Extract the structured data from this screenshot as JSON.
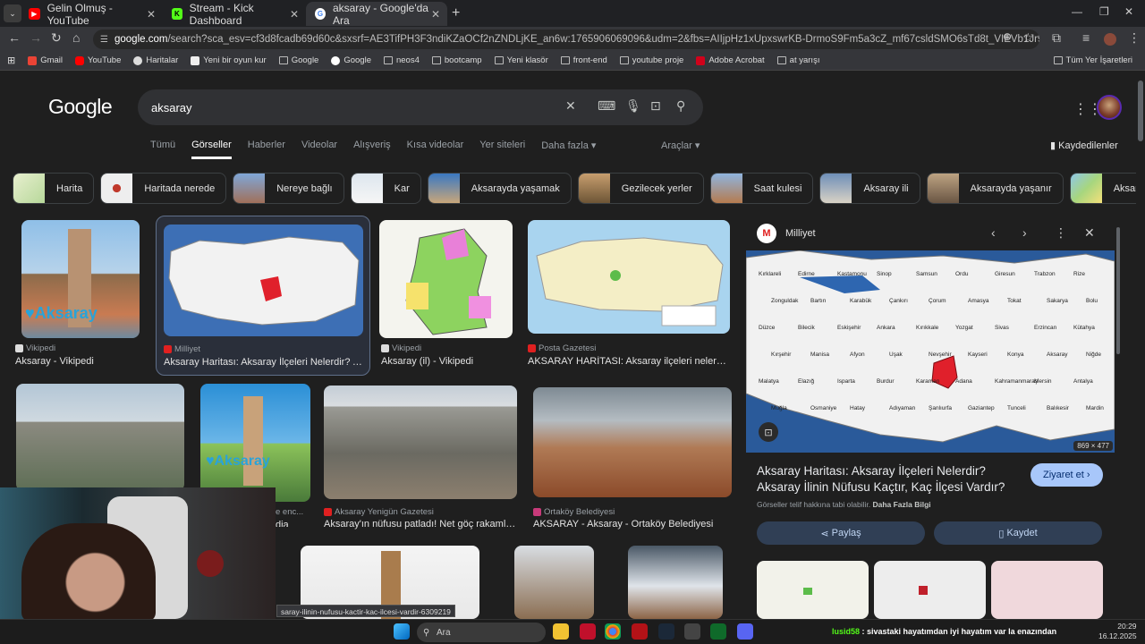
{
  "tabs": [
    {
      "title": "Gelin Olmuş - YouTube",
      "color": "#ff0000",
      "glyph": "▶"
    },
    {
      "title": "Stream - Kick Dashboard",
      "color": "#53fc18",
      "glyph": "K"
    },
    {
      "title": "aksaray - Google'da Ara",
      "color": "#ffffff",
      "glyph": "G"
    }
  ],
  "url": {
    "host": "google.com",
    "rest": "/search?sca_esv=cf3d8fcadb69d60c&sxsrf=AE3TifPH3F3ndiKZaOCf2nZNDLjKE_an6w:1765906069096&udm=2&fbs=AIIjpHz1xUpxswrKB-DrmoS9Fm5a3cZ_mf67csldSMO6sTd8t_VIEVb1Jr9xw1JF7Lq8CmkqOt0ZSNMrQxXLUVYBZ..."
  },
  "bookmarks": [
    "Gmail",
    "YouTube",
    "Haritalar",
    "Yeni bir oyun kur",
    "Google",
    "Google",
    "neos4",
    "bootcamp",
    "Yeni klasör",
    "front-end",
    "youtube proje",
    "Adobe Acrobat",
    "at yarışı"
  ],
  "all_bookmarks": "Tüm Yer İşaretleri",
  "logo": "Google",
  "query": "aksaray",
  "nav": [
    "Tümü",
    "Görseller",
    "Haberler",
    "Videolar",
    "Alışveriş",
    "Kısa videolar",
    "Yer siteleri",
    "Daha fazla"
  ],
  "tools": "Araçlar",
  "saved": "Kaydedilenler",
  "chips": [
    "Harita",
    "Haritada nerede",
    "Nereye bağlı",
    "Kar",
    "Aksarayda yaşamak",
    "Gezilecek yerler",
    "Saat kulesi",
    "Aksaray ili",
    "Aksarayda yaşanır",
    "Aksaray ilçeleri"
  ],
  "results": [
    {
      "source": "Vikipedi",
      "title": "Aksaray - Vikipedi"
    },
    {
      "source": "Milliyet",
      "title": "Aksaray Haritası: Aksaray İlçeleri Nelerdir? A..."
    },
    {
      "source": "Vikipedi",
      "title": "Aksaray (il) - Vikipedi"
    },
    {
      "source": "Posta Gazetesi",
      "title": "AKSARAY HARİTASI: Aksaray ilçeleri nelerdir..."
    },
    {
      "source": "",
      "title": ""
    },
    {
      "source": "e enc...",
      "title": "dia"
    },
    {
      "source": "Aksaray Yenigün Gazetesi",
      "title": "Aksaray'ın nüfusu patladı! Net göç rakamla..."
    },
    {
      "source": "Ortaköy Belediyesi",
      "title": "AKSARAY - Aksaray - Ortaköy Belediyesi"
    }
  ],
  "panel": {
    "source": "Milliyet",
    "dims": "869 × 477",
    "title": "Aksaray Haritası: Aksaray İlçeleri Nelerdir? Aksaray İlinin Nüfusu Kaçtır, Kaç İlçesi Vardır?",
    "visit": "Ziyaret et",
    "rights": "Görseller telif hakkına tabi olabilir.",
    "more": "Daha Fazla Bilgi",
    "share": "Paylaş",
    "save": "Kaydet",
    "cities": [
      "Kırklareli",
      "Edirne",
      "Kastamonu",
      "Sinop",
      "Samsun",
      "Ordu",
      "Giresun",
      "Trabzon",
      "Rize",
      "Zonguldak",
      "Bartın",
      "Karabük",
      "Çankırı",
      "Çorum",
      "Amasya",
      "Tokat",
      "Sakarya",
      "Bolu",
      "Düzce",
      "Bilecik",
      "Eskişehir",
      "Ankara",
      "Kırıkkale",
      "Yozgat",
      "Sivas",
      "Erzincan",
      "Kütahya",
      "Kırşehir",
      "Manisa",
      "Afyon",
      "Uşak",
      "Nevşehir",
      "Kayseri",
      "Konya",
      "Aksaray",
      "Niğde",
      "Malatya",
      "Elazığ",
      "Isparta",
      "Burdur",
      "Karaman",
      "Adana",
      "Kahramanmaraş",
      "Mersin",
      "Antalya",
      "Muğla",
      "Osmaniye",
      "Hatay",
      "Adıyaman",
      "Şanlıurfa",
      "Gaziantep",
      "Tunceli",
      "Balıkesir",
      "Mardin"
    ]
  },
  "url_tooltip": "saray-ilinin-nufusu-kactir-kac-ilcesi-vardir-6309219",
  "taskbar": {
    "search": "Ara",
    "ticker_user": "lusid58",
    "ticker_text": "sivastaki hayatımdan iyi hayatım var la enazından",
    "time": "20:29",
    "date": "16.12.2025"
  }
}
